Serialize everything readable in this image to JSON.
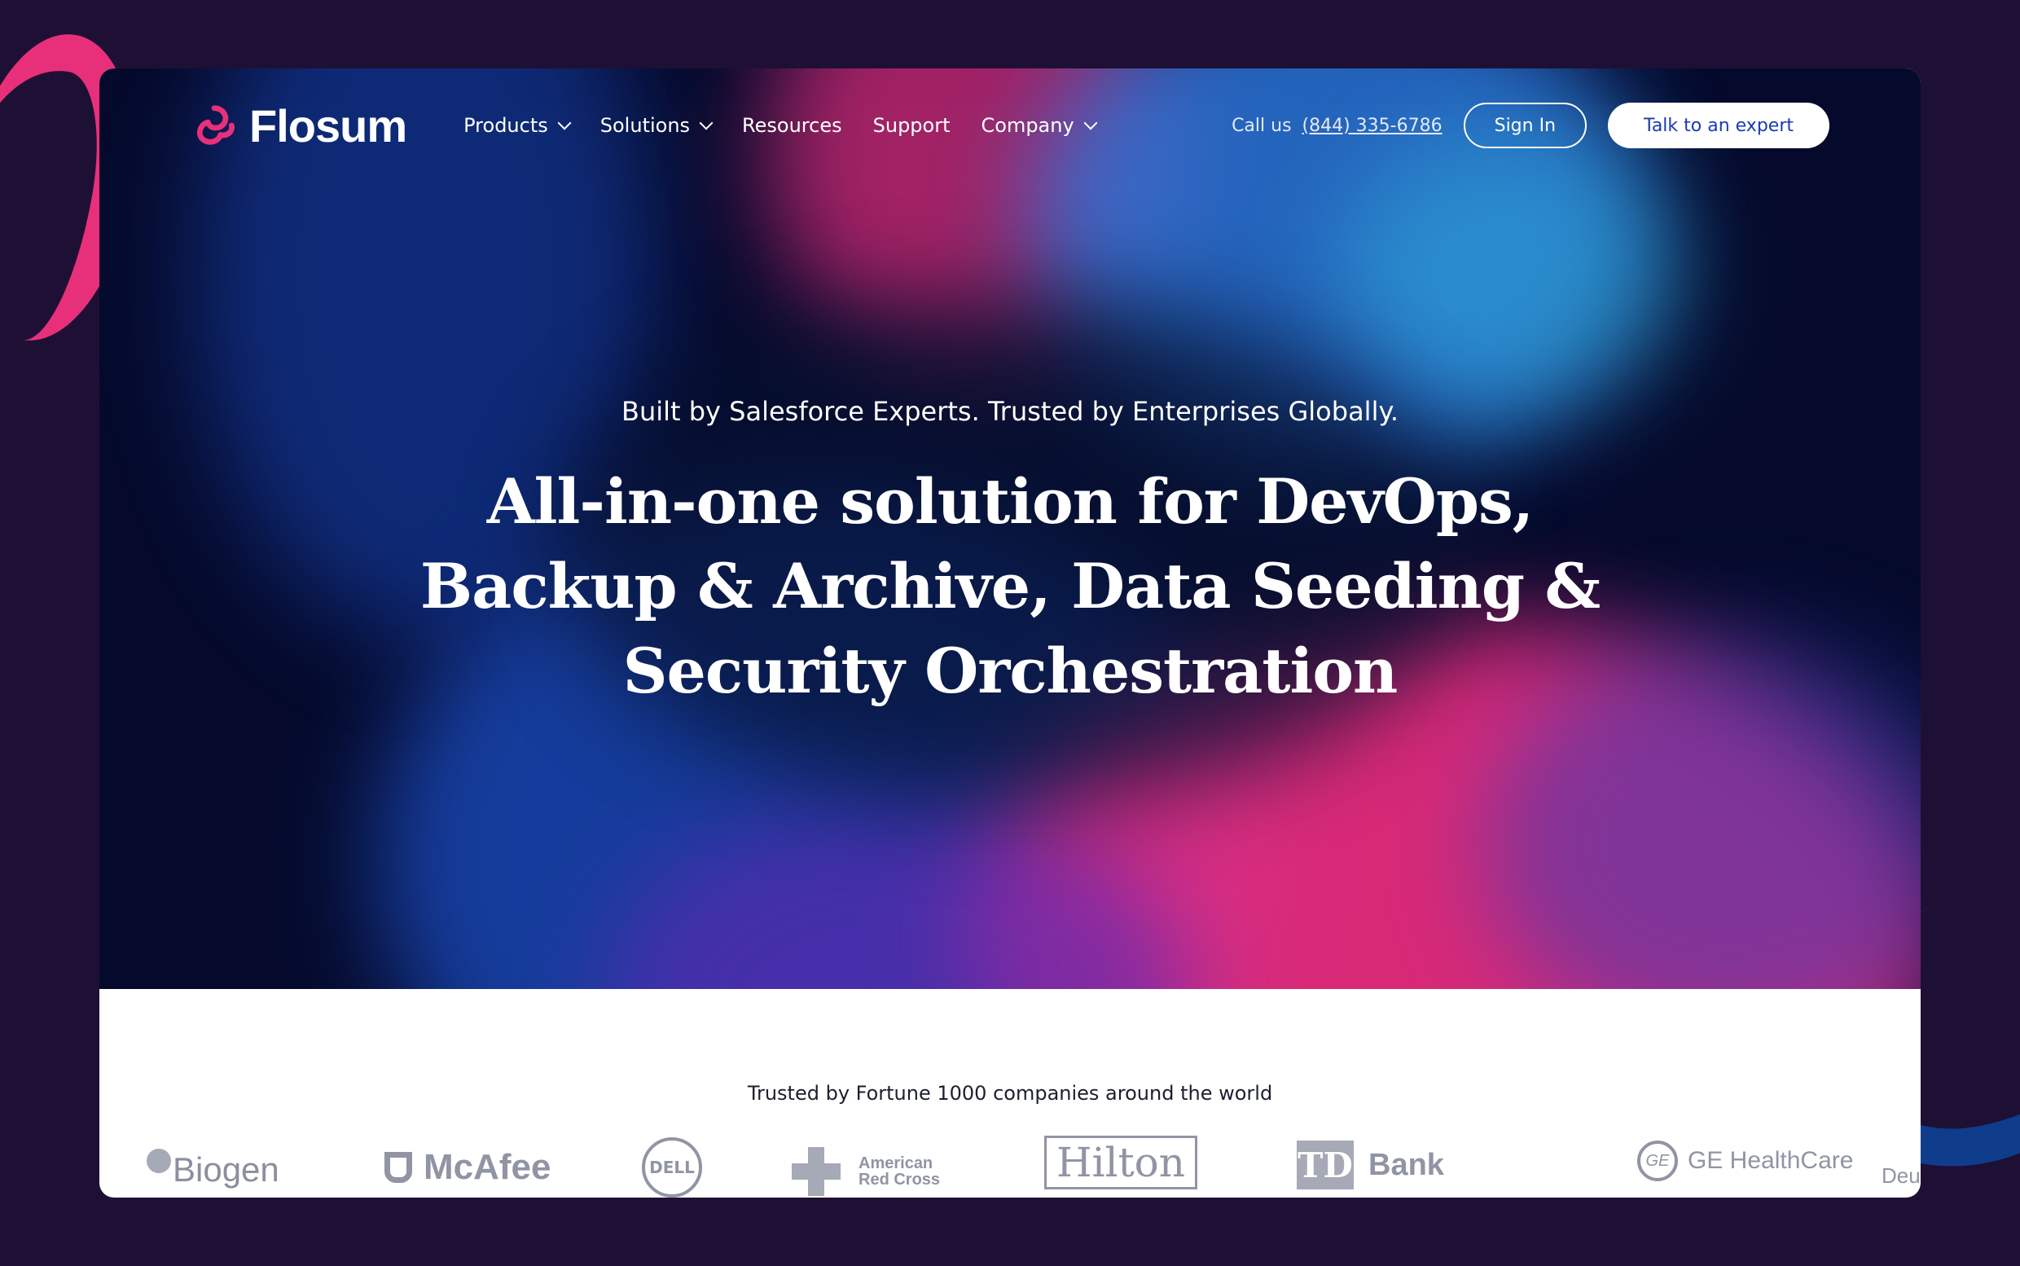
{
  "brand": {
    "name": "Flosum",
    "logo_color": "#e8307a"
  },
  "nav": {
    "items": [
      {
        "label": "Products",
        "has_dropdown": true
      },
      {
        "label": "Solutions",
        "has_dropdown": true
      },
      {
        "label": "Resources",
        "has_dropdown": false
      },
      {
        "label": "Support",
        "has_dropdown": false
      },
      {
        "label": "Company",
        "has_dropdown": true
      }
    ],
    "call_label": "Call us",
    "phone": "(844) 335-6786",
    "sign_in": "Sign In",
    "cta": "Talk to an expert"
  },
  "hero": {
    "eyebrow": "Built by Salesforce Experts. Trusted by Enterprises Globally.",
    "headline_lines": [
      "All-in-one solution for DevOps,",
      "Backup & Archive, Data Seeding &",
      "Security Orchestration"
    ]
  },
  "trusted": {
    "text": "Trusted by Fortune 1000 companies around the world",
    "logos": [
      {
        "name": "Biogen",
        "icon": "biogen-logo"
      },
      {
        "name": "McAfee",
        "icon": "mcafee-logo"
      },
      {
        "name": "DELL",
        "icon": "dell-logo"
      },
      {
        "name_line1": "American",
        "name_line2": "Red Cross",
        "icon": "red-cross-logo"
      },
      {
        "name": "Hilton",
        "icon": "hilton-logo"
      },
      {
        "box": "TD",
        "name": "Bank",
        "icon": "td-bank-logo"
      },
      {
        "emblem": "GE",
        "name": "GE HealthCare",
        "icon": "ge-healthcare-logo"
      },
      {
        "name": "Deutsche Ba",
        "icon": "deutsche-bank-logo"
      }
    ]
  },
  "colors": {
    "backdrop": "#1e1034",
    "accent_pink": "#e8307a",
    "accent_blue": "#1a3ab0",
    "logo_gray": "#9094a4"
  }
}
